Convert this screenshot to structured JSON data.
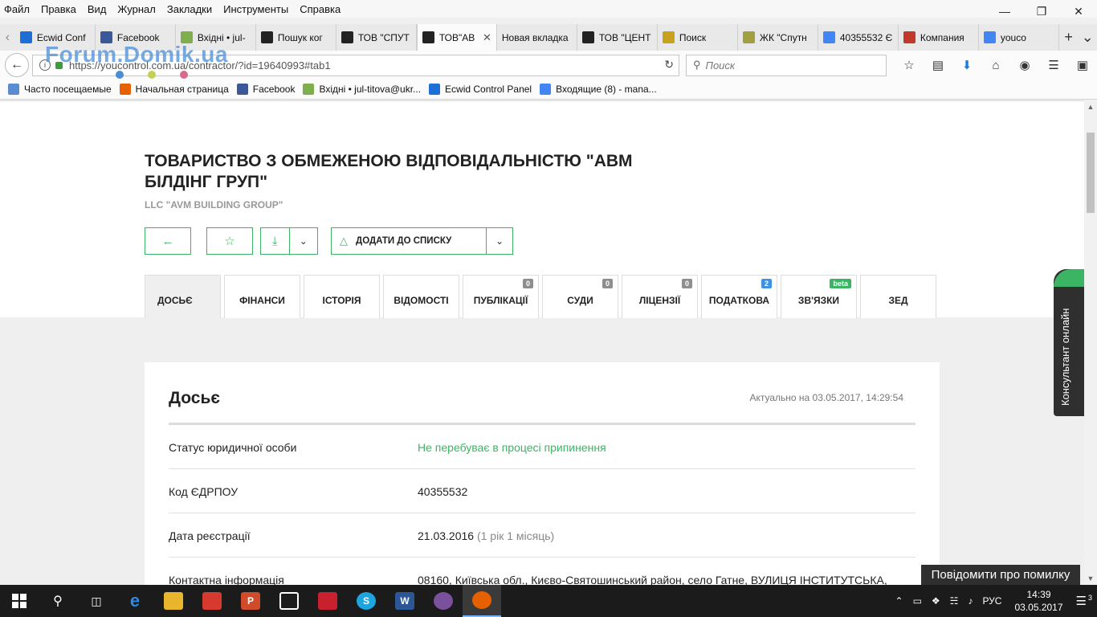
{
  "browser": {
    "menu": [
      "Файл",
      "Правка",
      "Вид",
      "Журнал",
      "Закладки",
      "Инструменты",
      "Справка"
    ],
    "tabs": [
      {
        "label": "Ecwid Conf",
        "icon": "ecwid-icon",
        "color": "#1b6fd6"
      },
      {
        "label": "Facebook",
        "icon": "facebook-icon",
        "color": "#3b5998"
      },
      {
        "label": "Вхідні • jul-",
        "icon": "mail-icon",
        "color": "#7fae4d"
      },
      {
        "label": "Пошук ког",
        "icon": "youcontrol-icon",
        "color": "#222222"
      },
      {
        "label": "ТОВ \"СПУТ",
        "icon": "youcontrol-icon",
        "color": "#222222"
      },
      {
        "label": "ТОВ\"АВ",
        "icon": "youcontrol-icon",
        "color": "#222222",
        "active": true
      },
      {
        "label": "Новая вкладка",
        "icon": "",
        "color": ""
      },
      {
        "label": "ТОВ \"ЦЕНТ",
        "icon": "youcontrol-icon",
        "color": "#222222"
      },
      {
        "label": "Поиск",
        "icon": "home-icon",
        "color": "#c8a21c"
      },
      {
        "label": "ЖК \"Спутн",
        "icon": "image-icon",
        "color": "#a0a040"
      },
      {
        "label": "40355532 Є",
        "icon": "google-icon",
        "color": "#4285f4"
      },
      {
        "label": "Компания",
        "icon": "flower-icon",
        "color": "#c0392b"
      },
      {
        "label": "youco",
        "icon": "google-icon",
        "color": "#4285f4"
      }
    ],
    "url": "https://youcontrol.com.ua/contractor/?id=19640993#tab1",
    "search_placeholder": "Поиск",
    "watermark": "Forum.Domik.ua",
    "bookmarks": [
      {
        "label": "Часто посещаемые",
        "icon": "gear-icon",
        "color": "#5b8bd0"
      },
      {
        "label": "Начальная страница",
        "icon": "firefox-icon",
        "color": "#e66000"
      },
      {
        "label": "Facebook",
        "icon": "facebook-icon",
        "color": "#3b5998"
      },
      {
        "label": "Вхідні • jul-titova@ukr...",
        "icon": "mail-icon",
        "color": "#7fae4d"
      },
      {
        "label": "Ecwid Control Panel",
        "icon": "ecwid-icon",
        "color": "#1b6fd6"
      },
      {
        "label": "Входящие (8) - mana...",
        "icon": "google-icon",
        "color": "#4285f4"
      }
    ]
  },
  "company": {
    "title": "ТОВАРИСТВО З ОБМЕЖЕНОЮ ВІДПОВІДАЛЬНІСТЮ \"АВМ БІЛДІНГ ГРУП\"",
    "subtitle": "LLC \"AVM BUILDING GROUP\"",
    "add_to_list": "ДОДАТИ ДО СПИСКУ"
  },
  "tabs": [
    {
      "label": "ДОСЬЄ",
      "badge": ""
    },
    {
      "label": "ФІНАНСИ",
      "badge": ""
    },
    {
      "label": "ІСТОРІЯ",
      "badge": ""
    },
    {
      "label": "ВІДОМОСТІ",
      "badge": ""
    },
    {
      "label": "ПУБЛІКАЦІЇ",
      "badge": "0"
    },
    {
      "label": "СУДИ",
      "badge": "0"
    },
    {
      "label": "ЛІЦЕНЗІЇ",
      "badge": "0"
    },
    {
      "label": "ПОДАТКОВА",
      "badge": "2"
    },
    {
      "label": "ЗВ'ЯЗКИ",
      "badge": "beta"
    },
    {
      "label": "ЗЕД",
      "badge": ""
    }
  ],
  "dossier": {
    "title": "Досьє",
    "updated": "Актуально на 03.05.2017, 14:29:54",
    "rows": [
      {
        "key": "Статус юридичної особи",
        "value": "Не перебуває в процесі припинення",
        "extra": ""
      },
      {
        "key": "Код ЄДРПОУ",
        "value": "40355532",
        "extra": ""
      },
      {
        "key": "Дата реєстрації",
        "value": "21.03.2016",
        "extra": "(1 рік 1 місяць)"
      },
      {
        "key": "Контактна інформація",
        "value": "08160, Київська обл., Києво-Святошинський район, село Гатне, ВУЛИЦЯ ІНСТИТУТСЬКА,",
        "extra": ""
      }
    ]
  },
  "consultant": "Консультант онлайн",
  "report_error": "Повідомити про помилку",
  "taskbar": {
    "lang": "РУС",
    "time": "14:39",
    "date": "03.05.2017",
    "notifications": "3"
  },
  "colors": {
    "accent": "#3bb563",
    "dark": "#2f2f2f"
  }
}
